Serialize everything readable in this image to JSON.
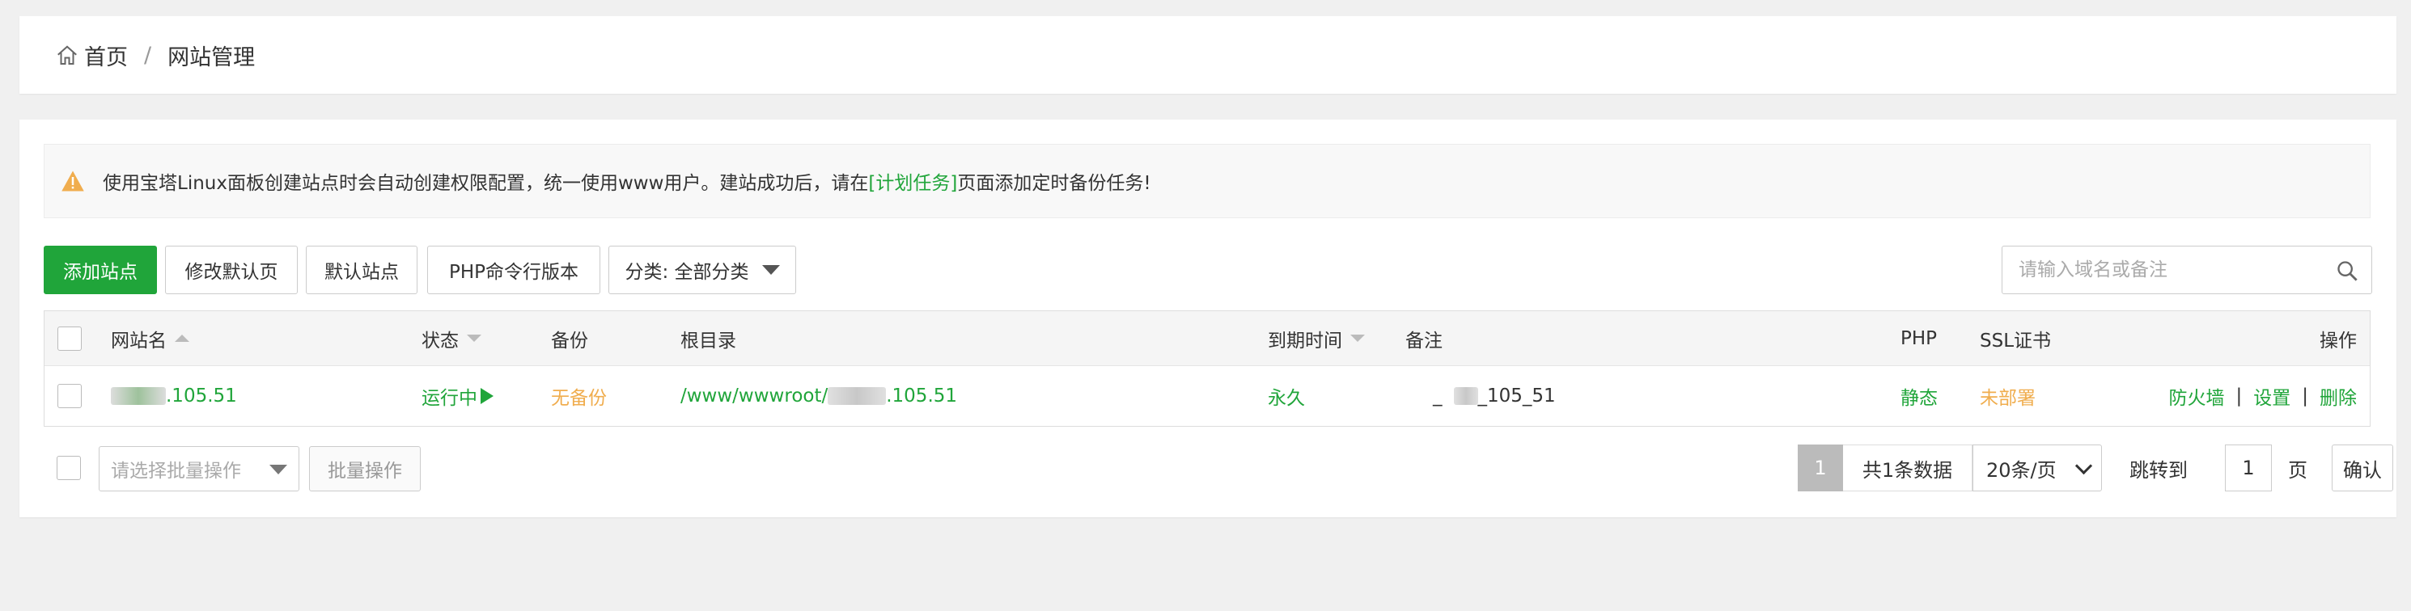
{
  "breadcrumb": {
    "home": "首页",
    "separator": "/",
    "current": "网站管理"
  },
  "alert": {
    "icon": "warning-icon",
    "text_before": "使用宝塔Linux面板创建站点时会自动创建权限配置，统一使用www用户。建站成功后，请在",
    "link": "[计划任务]",
    "text_after": "页面添加定时备份任务!"
  },
  "toolbar": {
    "add_site": "添加站点",
    "modify_default_page": "修改默认页",
    "default_site": "默认站点",
    "php_cli_version": "PHP命令行版本",
    "category": "分类: 全部分类",
    "search_placeholder": "请输入域名或备注"
  },
  "table": {
    "headers": {
      "site_name": "网站名",
      "status": "状态",
      "backup": "备份",
      "root_dir": "根目录",
      "expire": "到期时间",
      "remark": "备注",
      "php": "PHP",
      "ssl": "SSL证书",
      "actions": "操作"
    },
    "rows": [
      {
        "site_name_suffix": ".105.51",
        "status": "运行中",
        "backup": "无备份",
        "root_prefix": "/www/wwwroot/",
        "root_suffix": ".105.51",
        "expire": "永久",
        "remark_prefix": "_",
        "remark_suffix": "_105_51",
        "php": "静态",
        "ssl": "未部署",
        "actions": [
          "防火墙",
          "设置",
          "删除"
        ],
        "action_separator": "|"
      }
    ]
  },
  "footer": {
    "batch_select_placeholder": "请选择批量操作",
    "batch_button": "批量操作",
    "current_page": "1",
    "total": "共1条数据",
    "per_page": "20条/页",
    "jump_to": "跳转到",
    "jump_value": "1",
    "page_unit": "页",
    "confirm": "确认"
  },
  "colors": {
    "accent": "#20a53a",
    "warning": "#f0ad4e",
    "background": "#f0f0f0"
  }
}
